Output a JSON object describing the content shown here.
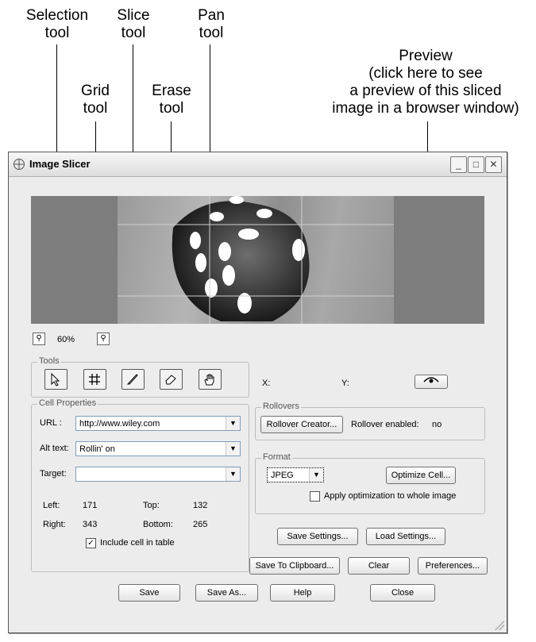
{
  "callouts": {
    "selection": [
      "Selection",
      "tool"
    ],
    "grid": [
      "Grid",
      "tool"
    ],
    "slice": [
      "Slice",
      "tool"
    ],
    "erase": [
      "Erase",
      "tool"
    ],
    "pan": [
      "Pan",
      "tool"
    ],
    "preview": [
      "Preview",
      "(click here to see",
      "a preview of this sliced",
      "image in a browser window)"
    ]
  },
  "window": {
    "title": "Image Slicer",
    "zoom_level": "60%"
  },
  "tools": {
    "group_label": "Tools",
    "items": [
      "selection-tool",
      "grid-tool",
      "slice-tool",
      "erase-tool",
      "pan-tool"
    ]
  },
  "cell_properties": {
    "group_label": "Cell Properties",
    "url_label": "URL :",
    "url_value": "http://www.wiley.com",
    "alt_label": "Alt text:",
    "alt_value": "Rollin' on",
    "target_label": "Target:",
    "target_value": "",
    "left_label": "Left:",
    "left_value": "171",
    "top_label": "Top:",
    "top_value": "132",
    "right_label": "Right:",
    "right_value": "343",
    "bottom_label": "Bottom:",
    "bottom_value": "265",
    "include_label": "Include cell in table",
    "include_checked": true
  },
  "coords": {
    "x_label": "X:",
    "y_label": "Y:"
  },
  "rollovers": {
    "group_label": "Rollovers",
    "creator_button": "Rollover Creator...",
    "enabled_label": "Rollover enabled:",
    "enabled_value": "no"
  },
  "format": {
    "group_label": "Format",
    "selected": "JPEG",
    "optimize_button": "Optimize Cell...",
    "apply_label": "Apply optimization to whole image",
    "apply_checked": false
  },
  "buttons": {
    "save_settings": "Save Settings...",
    "load_settings": "Load Settings...",
    "save_to_clipboard": "Save To Clipboard...",
    "clear": "Clear",
    "preferences": "Preferences...",
    "save": "Save",
    "save_as": "Save As...",
    "help": "Help",
    "close": "Close"
  }
}
